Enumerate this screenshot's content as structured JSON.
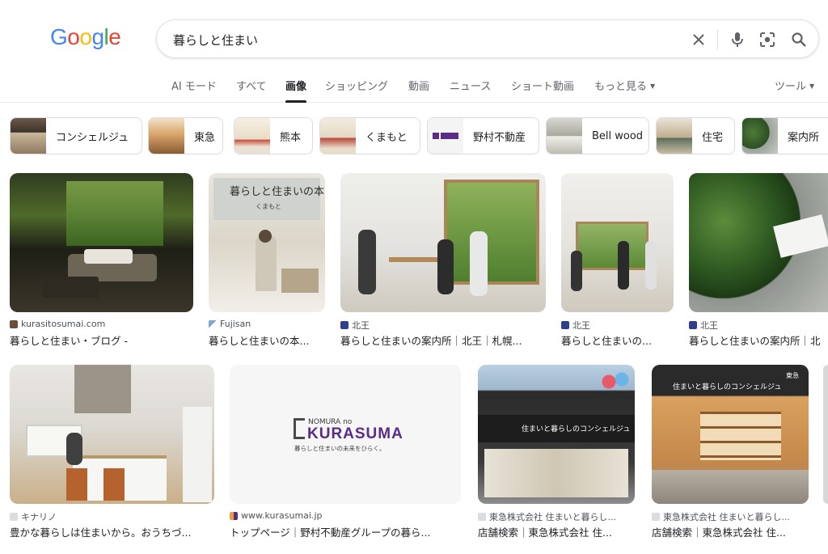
{
  "logo": {
    "letters": [
      "G",
      "o",
      "o",
      "g",
      "l",
      "e"
    ],
    "colors": [
      "#4285F4",
      "#EA4335",
      "#FBBC05",
      "#4285F4",
      "#34A853",
      "#EA4335"
    ]
  },
  "search": {
    "query": "暮らしと住まい"
  },
  "tabs": [
    {
      "label": "AI モード"
    },
    {
      "label": "すべて"
    },
    {
      "label": "画像"
    },
    {
      "label": "ショッピング"
    },
    {
      "label": "動画"
    },
    {
      "label": "ニュース"
    },
    {
      "label": "ショート動画"
    },
    {
      "label": "もっと見る"
    },
    {
      "label": "ツール"
    }
  ],
  "chips": [
    {
      "label": "コンシェルジュ"
    },
    {
      "label": "東急"
    },
    {
      "label": "熊本"
    },
    {
      "label": "くまもと"
    },
    {
      "label": "野村不動産"
    },
    {
      "label": "Bell wood"
    },
    {
      "label": "住宅"
    },
    {
      "label": "案内所"
    }
  ],
  "thumb_text": {
    "fujisan_title": "暮らしと住まいの本",
    "fujisan_sub": "くまもと",
    "nomura_top": "NOMURA no",
    "nomura_brand": "KURASUMA",
    "nomura_tagline": "暮らしと住まいの未来をひらく。",
    "tokyu_sign": "住まいと暮らしのコンシェルジュ",
    "tokyu_sign2": "住まいと暮らしのコンシェルジュ",
    "tokyu_logo": "東急"
  },
  "results": [
    {
      "source": "kurasitosumai.com",
      "title": "暮らしと住まい・ブログ -"
    },
    {
      "source": "Fujisan",
      "title": "暮らしと住まいの本..."
    },
    {
      "source": "北王",
      "title": "暮らしと住まいの案内所｜北王｜札幌..."
    },
    {
      "source": "北王",
      "title": "暮らしと住まいの..."
    },
    {
      "source": "北王",
      "title": "暮らしと住まいの案内所｜北"
    },
    {
      "source": "キナリノ",
      "title": "豊かな暮らしは住まいから。おうちづ..."
    },
    {
      "source": "www.kurasumai.jp",
      "title": "トップページ｜野村不動産グループの暮ら..."
    },
    {
      "source": "東急株式会社 住まいと暮らし...",
      "title": "店舗検索｜東急株式会社 住..."
    },
    {
      "source": "東急株式会社 住まいと暮らし...",
      "title": "店舗検索｜東急株式会社 住..."
    }
  ]
}
